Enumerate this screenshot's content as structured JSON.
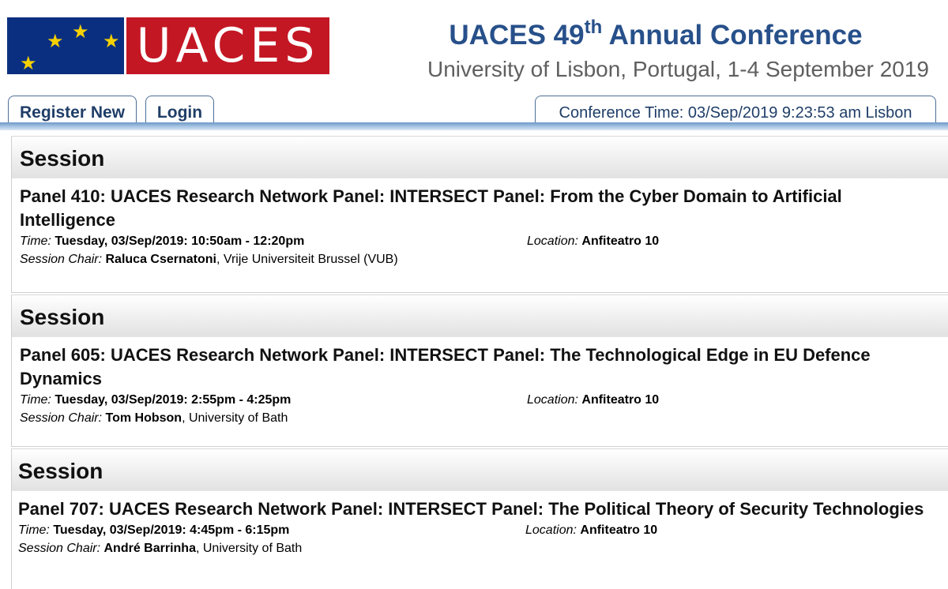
{
  "header": {
    "logo_text": "UACES",
    "title_pre": "UACES 49",
    "title_sup": "th",
    "title_post": " Annual Conference",
    "subtitle": "University of Lisbon, Portugal, 1-4 September 2019"
  },
  "nav": {
    "register_label": "Register New",
    "login_label": "Login",
    "conference_time": "Conference Time: 03/Sep/2019 9:23:53 am  Lisbon"
  },
  "labels": {
    "time": "Time:",
    "location": "Location:",
    "session_chair": "Session Chair:"
  },
  "colors": {
    "eu_blue": "#0b2f80",
    "eu_star": "#f5d100",
    "uaces_red": "#c41724",
    "title_blue": "#27508a",
    "nav_bar": "#6f98c6"
  },
  "sessions": [
    {
      "header": "Session",
      "panel_title": "Panel 410: UACES Research Network Panel: INTERSECT Panel: From the Cyber Domain to Artificial Intelligence",
      "time": "Tuesday, 03/Sep/2019: 10:50am - 12:20pm",
      "location": "Anfiteatro 10",
      "chair_name": "Raluca Csernatoni",
      "chair_affiliation": ", Vrije Universiteit Brussel (VUB)"
    },
    {
      "header": "Session",
      "panel_title": "Panel 605: UACES Research Network Panel: INTERSECT Panel: The Technological Edge in EU Defence Dynamics",
      "time": "Tuesday, 03/Sep/2019: 2:55pm - 4:25pm",
      "location": "Anfiteatro 10",
      "chair_name": "Tom Hobson",
      "chair_affiliation": ", University of Bath"
    },
    {
      "header": "Session",
      "panel_title": "Panel 707: UACES Research Network Panel: INTERSECT Panel: The Political Theory of Security Technologies",
      "time": "Tuesday, 03/Sep/2019: 4:45pm - 6:15pm",
      "location": "Anfiteatro 10",
      "chair_name": "André Barrinha",
      "chair_affiliation": ", University of Bath"
    }
  ]
}
